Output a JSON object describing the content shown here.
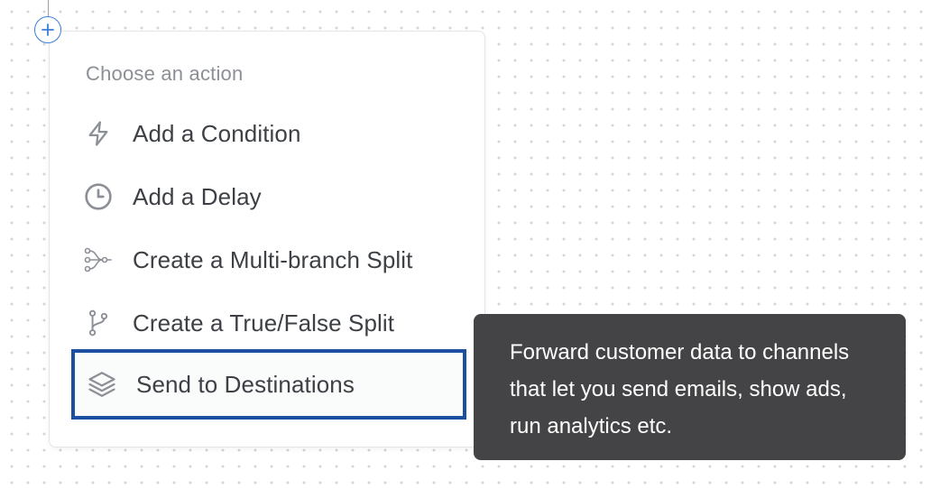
{
  "canvas": {
    "add_button_icon": "plus-icon"
  },
  "menu": {
    "heading": "Choose an action",
    "items": [
      {
        "label": "Add a Condition",
        "icon": "lightning-icon"
      },
      {
        "label": "Add a Delay",
        "icon": "clock-icon"
      },
      {
        "label": "Create a Multi-branch Split",
        "icon": "multi-branch-icon"
      },
      {
        "label": "Create a True/False Split",
        "icon": "branch-fork-icon"
      },
      {
        "label": "Send to Destinations",
        "icon": "layers-icon",
        "selected": true
      }
    ]
  },
  "tooltip": {
    "text": "Forward customer data to channels that let you send emails, show ads, run analytics etc."
  },
  "colors": {
    "accent": "#3b7ed8",
    "selected_border": "#1c4fa0",
    "tooltip_bg": "#444446",
    "icon_gray": "#8c9096"
  }
}
